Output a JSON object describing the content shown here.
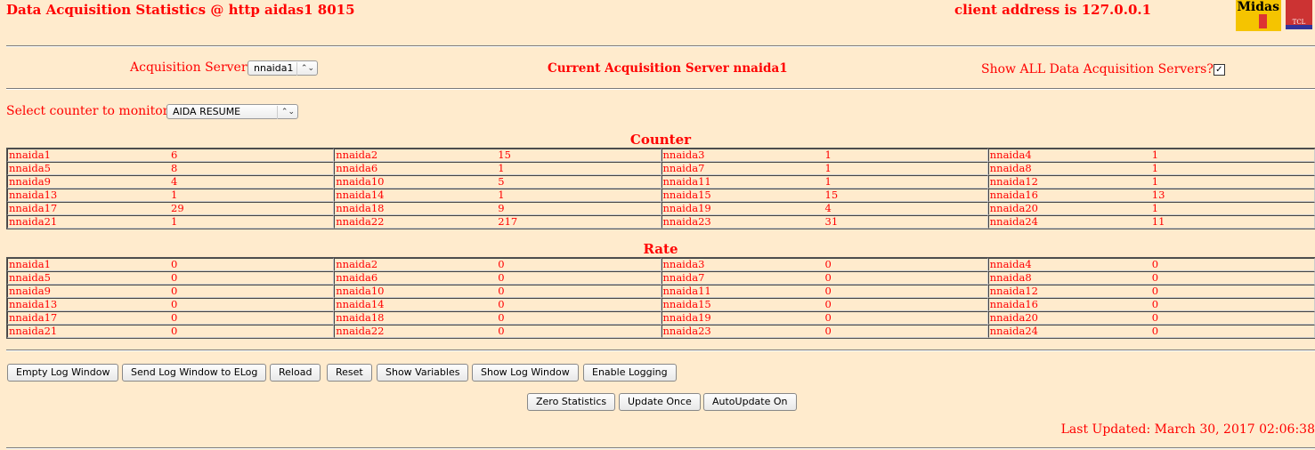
{
  "header": {
    "title": "Data Acquisition Statistics @ http aidas1 8015",
    "client": "client address is 127.0.0.1",
    "logo_midas": "Midas",
    "logo_tcl": "TCL"
  },
  "servers": {
    "label": "Acquisition Servers",
    "selected": "nnaida1",
    "current": "Current Acquisition Server nnaida1",
    "show_all_label": "Show ALL Data Acquisition Servers?",
    "show_all_checked": true
  },
  "counter_select": {
    "label": "Select counter to monitor",
    "selected": "AIDA RESUME"
  },
  "counter": {
    "title": "Counter",
    "values": [
      6,
      15,
      1,
      1,
      8,
      1,
      1,
      1,
      4,
      5,
      1,
      1,
      1,
      1,
      15,
      13,
      29,
      9,
      4,
      1,
      1,
      217,
      31,
      11
    ]
  },
  "rate": {
    "title": "Rate",
    "values": [
      0,
      0,
      0,
      0,
      0,
      0,
      0,
      0,
      0,
      0,
      0,
      0,
      0,
      0,
      0,
      0,
      0,
      0,
      0,
      0,
      0,
      0,
      0,
      0
    ]
  },
  "names": [
    "nnaida1",
    "nnaida2",
    "nnaida3",
    "nnaida4",
    "nnaida5",
    "nnaida6",
    "nnaida7",
    "nnaida8",
    "nnaida9",
    "nnaida10",
    "nnaida11",
    "nnaida12",
    "nnaida13",
    "nnaida14",
    "nnaida15",
    "nnaida16",
    "nnaida17",
    "nnaida18",
    "nnaida19",
    "nnaida20",
    "nnaida21",
    "nnaida22",
    "nnaida23",
    "nnaida24"
  ],
  "buttons": {
    "empty_log": "Empty Log Window",
    "send_log": "Send Log Window to ELog",
    "reload": "Reload",
    "reset": "Reset",
    "show_vars": "Show Variables",
    "show_log": "Show Log Window",
    "enable_logging": "Enable Logging",
    "zero_stats": "Zero Statistics",
    "update_once": "Update Once",
    "autoupdate": "AutoUpdate On"
  },
  "footer": {
    "last_updated": "Last Updated: March 30, 2017 02:06:38"
  }
}
